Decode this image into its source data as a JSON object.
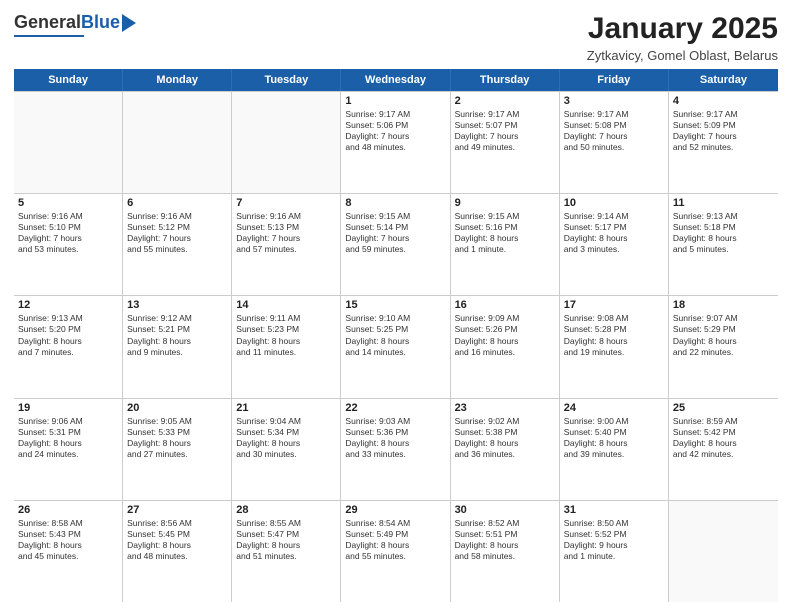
{
  "logo": {
    "general": "General",
    "blue": "Blue"
  },
  "title": "January 2025",
  "subtitle": "Zytkavicy, Gomel Oblast, Belarus",
  "days": [
    "Sunday",
    "Monday",
    "Tuesday",
    "Wednesday",
    "Thursday",
    "Friday",
    "Saturday"
  ],
  "weeks": [
    [
      {
        "day": "",
        "text": "",
        "empty": true
      },
      {
        "day": "",
        "text": "",
        "empty": true
      },
      {
        "day": "",
        "text": "",
        "empty": true
      },
      {
        "day": "1",
        "text": "Sunrise: 9:17 AM\nSunset: 5:06 PM\nDaylight: 7 hours\nand 48 minutes."
      },
      {
        "day": "2",
        "text": "Sunrise: 9:17 AM\nSunset: 5:07 PM\nDaylight: 7 hours\nand 49 minutes."
      },
      {
        "day": "3",
        "text": "Sunrise: 9:17 AM\nSunset: 5:08 PM\nDaylight: 7 hours\nand 50 minutes."
      },
      {
        "day": "4",
        "text": "Sunrise: 9:17 AM\nSunset: 5:09 PM\nDaylight: 7 hours\nand 52 minutes."
      }
    ],
    [
      {
        "day": "5",
        "text": "Sunrise: 9:16 AM\nSunset: 5:10 PM\nDaylight: 7 hours\nand 53 minutes."
      },
      {
        "day": "6",
        "text": "Sunrise: 9:16 AM\nSunset: 5:12 PM\nDaylight: 7 hours\nand 55 minutes."
      },
      {
        "day": "7",
        "text": "Sunrise: 9:16 AM\nSunset: 5:13 PM\nDaylight: 7 hours\nand 57 minutes."
      },
      {
        "day": "8",
        "text": "Sunrise: 9:15 AM\nSunset: 5:14 PM\nDaylight: 7 hours\nand 59 minutes."
      },
      {
        "day": "9",
        "text": "Sunrise: 9:15 AM\nSunset: 5:16 PM\nDaylight: 8 hours\nand 1 minute."
      },
      {
        "day": "10",
        "text": "Sunrise: 9:14 AM\nSunset: 5:17 PM\nDaylight: 8 hours\nand 3 minutes."
      },
      {
        "day": "11",
        "text": "Sunrise: 9:13 AM\nSunset: 5:18 PM\nDaylight: 8 hours\nand 5 minutes."
      }
    ],
    [
      {
        "day": "12",
        "text": "Sunrise: 9:13 AM\nSunset: 5:20 PM\nDaylight: 8 hours\nand 7 minutes."
      },
      {
        "day": "13",
        "text": "Sunrise: 9:12 AM\nSunset: 5:21 PM\nDaylight: 8 hours\nand 9 minutes."
      },
      {
        "day": "14",
        "text": "Sunrise: 9:11 AM\nSunset: 5:23 PM\nDaylight: 8 hours\nand 11 minutes."
      },
      {
        "day": "15",
        "text": "Sunrise: 9:10 AM\nSunset: 5:25 PM\nDaylight: 8 hours\nand 14 minutes."
      },
      {
        "day": "16",
        "text": "Sunrise: 9:09 AM\nSunset: 5:26 PM\nDaylight: 8 hours\nand 16 minutes."
      },
      {
        "day": "17",
        "text": "Sunrise: 9:08 AM\nSunset: 5:28 PM\nDaylight: 8 hours\nand 19 minutes."
      },
      {
        "day": "18",
        "text": "Sunrise: 9:07 AM\nSunset: 5:29 PM\nDaylight: 8 hours\nand 22 minutes."
      }
    ],
    [
      {
        "day": "19",
        "text": "Sunrise: 9:06 AM\nSunset: 5:31 PM\nDaylight: 8 hours\nand 24 minutes."
      },
      {
        "day": "20",
        "text": "Sunrise: 9:05 AM\nSunset: 5:33 PM\nDaylight: 8 hours\nand 27 minutes."
      },
      {
        "day": "21",
        "text": "Sunrise: 9:04 AM\nSunset: 5:34 PM\nDaylight: 8 hours\nand 30 minutes."
      },
      {
        "day": "22",
        "text": "Sunrise: 9:03 AM\nSunset: 5:36 PM\nDaylight: 8 hours\nand 33 minutes."
      },
      {
        "day": "23",
        "text": "Sunrise: 9:02 AM\nSunset: 5:38 PM\nDaylight: 8 hours\nand 36 minutes."
      },
      {
        "day": "24",
        "text": "Sunrise: 9:00 AM\nSunset: 5:40 PM\nDaylight: 8 hours\nand 39 minutes."
      },
      {
        "day": "25",
        "text": "Sunrise: 8:59 AM\nSunset: 5:42 PM\nDaylight: 8 hours\nand 42 minutes."
      }
    ],
    [
      {
        "day": "26",
        "text": "Sunrise: 8:58 AM\nSunset: 5:43 PM\nDaylight: 8 hours\nand 45 minutes."
      },
      {
        "day": "27",
        "text": "Sunrise: 8:56 AM\nSunset: 5:45 PM\nDaylight: 8 hours\nand 48 minutes."
      },
      {
        "day": "28",
        "text": "Sunrise: 8:55 AM\nSunset: 5:47 PM\nDaylight: 8 hours\nand 51 minutes."
      },
      {
        "day": "29",
        "text": "Sunrise: 8:54 AM\nSunset: 5:49 PM\nDaylight: 8 hours\nand 55 minutes."
      },
      {
        "day": "30",
        "text": "Sunrise: 8:52 AM\nSunset: 5:51 PM\nDaylight: 8 hours\nand 58 minutes."
      },
      {
        "day": "31",
        "text": "Sunrise: 8:50 AM\nSunset: 5:52 PM\nDaylight: 9 hours\nand 1 minute."
      },
      {
        "day": "",
        "text": "",
        "empty": true
      }
    ]
  ]
}
